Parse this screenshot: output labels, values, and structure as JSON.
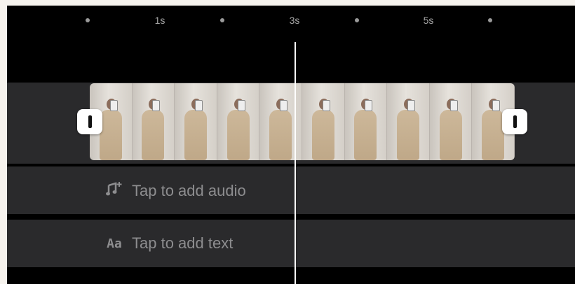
{
  "timeline": {
    "ruler_labels": [
      "1s",
      "3s",
      "5s"
    ]
  },
  "tracks": {
    "audio": {
      "icon": "music-note-add-icon",
      "label": "Tap to add audio"
    },
    "text": {
      "icon": "text-aa-icon",
      "icon_text": "Aa",
      "label": "Tap to add text"
    }
  },
  "clip": {
    "frame_count": 10
  },
  "colors": {
    "background": "#000000",
    "track": "#2a2a2c",
    "placeholder_text": "#8d8d8f",
    "playhead": "#ffffff"
  }
}
